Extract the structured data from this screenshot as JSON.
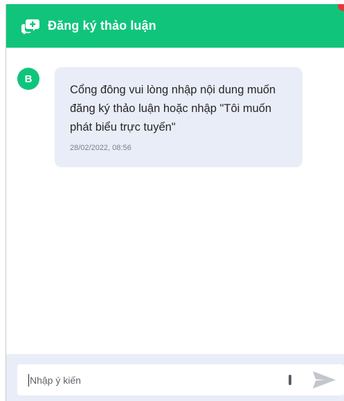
{
  "header": {
    "title": "Đăng ký thảo luận",
    "background": "#10c47c"
  },
  "message": {
    "avatar_letter": "B",
    "text": "Cổng đông vui lòng nhập nội dung muốn đăng ký thảo luận hoặc nhập \"Tôi muốn phát biểu trực tuyến\"",
    "timestamp": "28/02/2022, 08:56"
  },
  "composer": {
    "placeholder": "Nhập ý kiến",
    "send_icon": "send-icon",
    "mic_icon": "mic-icon"
  }
}
